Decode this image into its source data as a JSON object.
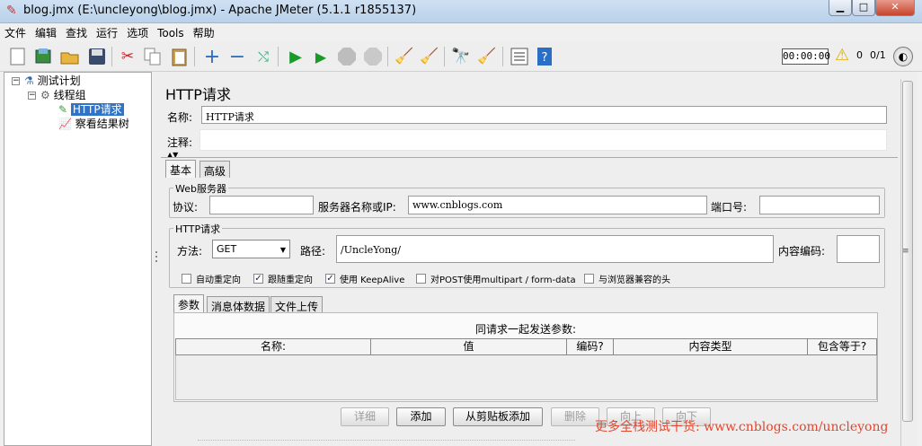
{
  "window": {
    "title": "blog.jmx (E:\\uncleyong\\blog.jmx) - Apache JMeter (5.1.1 r1855137)"
  },
  "menu": [
    "文件",
    "编辑",
    "查找",
    "运行",
    "选项",
    "Tools",
    "帮助"
  ],
  "toolbar": {
    "timer": "00:00:00",
    "warning_count": "0",
    "threads": "0/1"
  },
  "tree": {
    "root": "测试计划",
    "group": "线程组",
    "sampler": "HTTP请求",
    "listener": "察看结果树"
  },
  "editor": {
    "title": "HTTP请求",
    "name_label": "名称:",
    "name_value": "HTTP请求",
    "comment_label": "注释:",
    "comment_value": "",
    "tabs": [
      "基本",
      "高级"
    ],
    "web_server": {
      "group_title": "Web服务器",
      "protocol_label": "协议:",
      "protocol_value": "",
      "server_label": "服务器名称或IP:",
      "server_value": "www.cnblogs.com",
      "port_label": "端口号:",
      "port_value": ""
    },
    "http_request": {
      "group_title": "HTTP请求",
      "method_label": "方法:",
      "method_value": "GET",
      "path_label": "路径:",
      "path_value": "/UncleYong/",
      "encoding_label": "内容编码:",
      "encoding_value": ""
    },
    "options": [
      {
        "label": "自动重定向",
        "checked": false
      },
      {
        "label": "跟随重定向",
        "checked": true
      },
      {
        "label": "使用 KeepAlive",
        "checked": true
      },
      {
        "label": "对POST使用multipart / form-data",
        "checked": false
      },
      {
        "label": "与浏览器兼容的头",
        "checked": false
      }
    ],
    "sub_tabs": [
      "参数",
      "消息体数据",
      "文件上传"
    ],
    "params_caption": "同请求一起发送参数:",
    "columns": [
      "名称:",
      "值",
      "编码?",
      "内容类型",
      "包含等于?"
    ],
    "buttons": [
      "详细",
      "添加",
      "从剪贴板添加",
      "删除",
      "向上",
      "向下"
    ]
  },
  "watermark": "更多全栈测试干货: www.cnblogs.com/uncleyong"
}
